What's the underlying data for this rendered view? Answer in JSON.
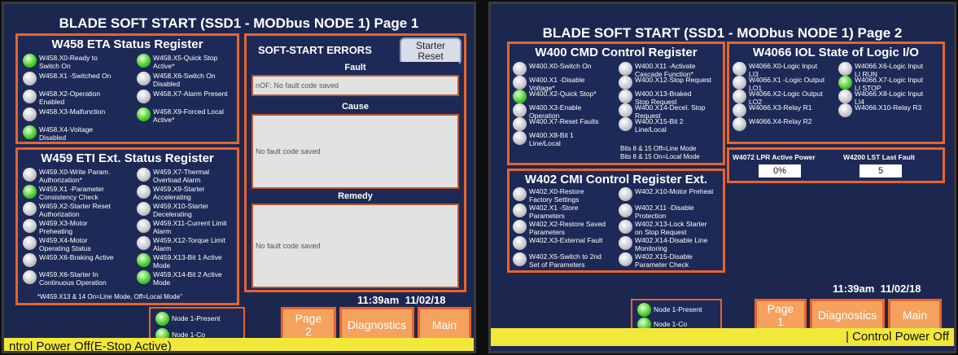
{
  "p1": {
    "title": "BLADE SOFT START (SSD1 - MODbus NODE 1) Page 1",
    "eta": {
      "title": "W458 ETA Status Register",
      "bits": [
        {
          "l": "W458.X0-Ready to\nSwitch On",
          "on": true
        },
        {
          "l": "W458.X1 -Switched On",
          "on": false
        },
        {
          "l": "W458.X2-Operation\nEnabled",
          "on": false
        },
        {
          "l": "W458.X3-Malfunction",
          "on": false
        },
        {
          "l": "W458.X4-Voltage\nDisabled",
          "on": true
        },
        {
          "l": "W458.X5-Quick Stop\nActive*",
          "on": true
        },
        {
          "l": "W458.X6-Switch On\nDisabled",
          "on": false
        },
        {
          "l": "W458.X7-Alarm Present",
          "on": false
        },
        {
          "l": "W458.X9-Forced Local\nActive*",
          "on": true
        }
      ]
    },
    "eti": {
      "title": "W459 ETI Ext. Status Register",
      "bits": [
        {
          "l": "W459.X0-Write Param.\nAuthorization*",
          "on": false
        },
        {
          "l": "W459.X1 -Parameter\nConsistency Check",
          "on": true
        },
        {
          "l": "W459.X2-Starter Reset\nAuthorization",
          "on": false
        },
        {
          "l": "W459.X3-Motor\nPreheating",
          "on": false
        },
        {
          "l": "W459.X4-Motor\nOperating Status",
          "on": false
        },
        {
          "l": "W459.X6-Braking Active",
          "on": false
        },
        {
          "l": "W459.X6-Starter In\nContinuous Operation",
          "on": false
        },
        {
          "l": "W459.X7-Thermal\nOverload Alarm",
          "on": false
        },
        {
          "l": "W459.X9-Starter\nAccelerating",
          "on": false
        },
        {
          "l": "W459.X10-Starter\nDecelerating",
          "on": false
        },
        {
          "l": "W459.X11-Current Limit\nAlarm",
          "on": false
        },
        {
          "l": "W459.X12-Torque Limit\nAlarm",
          "on": false
        },
        {
          "l": "W459.X13-Bit 1 Active\nMode",
          "on": true
        },
        {
          "l": "W459.X14-Bit 2 Active\nMode",
          "on": true
        }
      ],
      "note": "*W459.X13 & 14 On=Line Mode, Off=Local Mode\""
    },
    "errors": {
      "title": "SOFT-START ERRORS",
      "reset": "Starter\nReset",
      "fault_h": "Fault",
      "fault": "nOF: No fault code saved",
      "cause_h": "Cause",
      "cause": "No fault code saved",
      "remedy_h": "Remedy",
      "remedy": "No fault code saved"
    },
    "time": "11:39am",
    "date": "11/02/18",
    "node": "Node 1-Present",
    "node2": "Node 1-Co",
    "page_btn": "Page\n2",
    "diag_btn": "Diagnostics",
    "main_btn": "Main",
    "status": "ntrol Power Off(E-Stop Active)"
  },
  "p2": {
    "title": "BLADE SOFT START (SSD1 - MODbus NODE 1) Page 2",
    "cmd": {
      "title": "W400 CMD Control Register",
      "bits": [
        {
          "l": "W400.X0-Switch On",
          "on": false
        },
        {
          "l": "W400.X1 -Disable\nVoltage*",
          "on": false
        },
        {
          "l": "W400.X2-Quick Stop*",
          "on": true
        },
        {
          "l": "W400.X3-Enable\nOperation",
          "on": false
        },
        {
          "l": "W400.X7-Reset Faults",
          "on": false
        },
        {
          "l": "W400.X8-Bit 1\nLine/Local",
          "on": false
        },
        {
          "l": "W400.X11 -Activate\nCascade Function*",
          "on": false
        },
        {
          "l": "W400.X12-Stop Request",
          "on": false
        },
        {
          "l": "W400.X13-Braked\nStop Request",
          "on": false
        },
        {
          "l": "W400.X14-Decel. Stop\nRequest",
          "on": false
        },
        {
          "l": "W400.X15-Bit 2\nLine/Local",
          "on": false
        }
      ],
      "note1": "Bits 8 & 15 Off=Line Mode",
      "note2": "Bits 8 & 15 On=Local Mode"
    },
    "iol": {
      "title": "W4066 IOL State of Logic I/O",
      "bits": [
        {
          "l": "W4066.X0-Logic Input\nLI3",
          "on": false
        },
        {
          "l": "W4066.X1 -Logic Output\nLO1",
          "on": false
        },
        {
          "l": "W4066.X2-Logic Output\nLO2",
          "on": false
        },
        {
          "l": "W4066.X3-Relay R1",
          "on": false
        },
        {
          "l": "W4066.X4-Relay R2",
          "on": false
        },
        {
          "l": "W4066.X6-Logic Input\nLI RUN",
          "on": false
        },
        {
          "l": "W4066.X7-Logic Input\nLI STOP",
          "on": true
        },
        {
          "l": "W4066.X8-Logic Input\nLI4",
          "on": false
        },
        {
          "l": "W4066.X10-Relay R3",
          "on": false
        }
      ]
    },
    "power_label": "W4072 LPR Active Power",
    "power_value": "0%",
    "fault_label": "W4200 LST Last Fault",
    "fault_value": "5",
    "cmi": {
      "title": "W402 CMI Control Register Ext.",
      "bits": [
        {
          "l": "W402.X0-Restore\nFactory Settings",
          "on": false
        },
        {
          "l": "W402.X1 -Store\nParameters",
          "on": false
        },
        {
          "l": "W402.X2-Restore Saved\nParameters",
          "on": false
        },
        {
          "l": "W402.X3-External Fault",
          "on": false
        },
        {
          "l": "W402.X5-Switch to 2nd\nSet of Parameters",
          "on": false
        },
        {
          "l": "W402.X10-Motor Preheat",
          "on": false
        },
        {
          "l": "W402.X11 -Disable\nProtection",
          "on": false
        },
        {
          "l": "W402.X13-Lock Starter\non Stop Request",
          "on": false
        },
        {
          "l": "W402.X14-Disable Line\nMonitoring",
          "on": false
        },
        {
          "l": "W402.X15-Disable\nParameter Check",
          "on": false
        }
      ]
    },
    "time": "11:39am",
    "date": "11/02/18",
    "node": "Node 1-Present",
    "node2": "Node 1-Co",
    "page_btn": "Page\n1",
    "diag_btn": "Diagnostics",
    "main_btn": "Main",
    "status": "| Control Power Off"
  }
}
